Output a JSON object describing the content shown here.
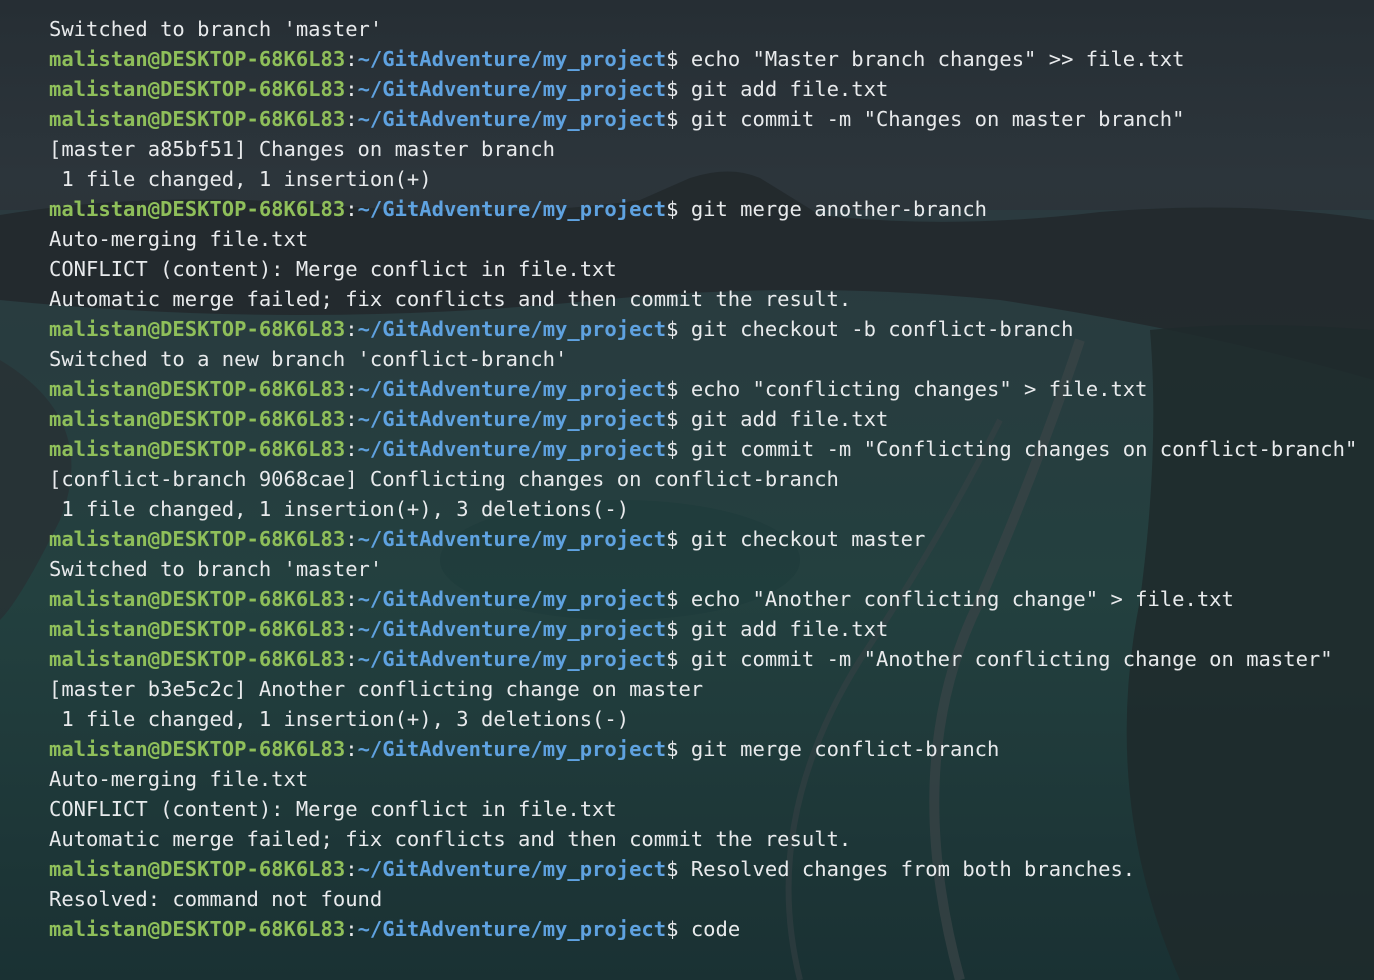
{
  "prompt": {
    "user_host": "malistan@DESKTOP-68K6L83",
    "separator": ":",
    "path": "~/GitAdventure/my_project",
    "symbol": "$ "
  },
  "lines": [
    {
      "type": "output",
      "text": "Switched to branch 'master'"
    },
    {
      "type": "prompt",
      "command": "echo \"Master branch changes\" >> file.txt"
    },
    {
      "type": "prompt",
      "command": "git add file.txt"
    },
    {
      "type": "prompt",
      "command": "git commit -m \"Changes on master branch\""
    },
    {
      "type": "output",
      "text": "[master a85bf51] Changes on master branch"
    },
    {
      "type": "output",
      "text": " 1 file changed, 1 insertion(+)"
    },
    {
      "type": "prompt",
      "command": "git merge another-branch"
    },
    {
      "type": "output",
      "text": "Auto-merging file.txt"
    },
    {
      "type": "output",
      "text": "CONFLICT (content): Merge conflict in file.txt"
    },
    {
      "type": "output",
      "text": "Automatic merge failed; fix conflicts and then commit the result."
    },
    {
      "type": "prompt",
      "command": "git checkout -b conflict-branch"
    },
    {
      "type": "output",
      "text": "Switched to a new branch 'conflict-branch'"
    },
    {
      "type": "prompt",
      "command": "echo \"conflicting changes\" > file.txt"
    },
    {
      "type": "prompt",
      "command": "git add file.txt"
    },
    {
      "type": "prompt",
      "command": "git commit -m \"Conflicting changes on conflict-branch\""
    },
    {
      "type": "output",
      "text": "[conflict-branch 9068cae] Conflicting changes on conflict-branch"
    },
    {
      "type": "output",
      "text": " 1 file changed, 1 insertion(+), 3 deletions(-)"
    },
    {
      "type": "prompt",
      "command": "git checkout master"
    },
    {
      "type": "output",
      "text": "Switched to branch 'master'"
    },
    {
      "type": "prompt",
      "command": "echo \"Another conflicting change\" > file.txt"
    },
    {
      "type": "prompt",
      "command": "git add file.txt"
    },
    {
      "type": "prompt",
      "command": "git commit -m \"Another conflicting change on master\""
    },
    {
      "type": "output",
      "text": "[master b3e5c2c] Another conflicting change on master"
    },
    {
      "type": "output",
      "text": " 1 file changed, 1 insertion(+), 3 deletions(-)"
    },
    {
      "type": "prompt",
      "command": "git merge conflict-branch"
    },
    {
      "type": "output",
      "text": "Auto-merging file.txt"
    },
    {
      "type": "output",
      "text": "CONFLICT (content): Merge conflict in file.txt"
    },
    {
      "type": "output",
      "text": "Automatic merge failed; fix conflicts and then commit the result."
    },
    {
      "type": "prompt",
      "command": "Resolved changes from both branches."
    },
    {
      "type": "output",
      "text": "Resolved: command not found"
    },
    {
      "type": "prompt",
      "command": "code"
    }
  ],
  "colors": {
    "user_host": "#8fbf5a",
    "path": "#5fa2e0",
    "text": "#e8eaec",
    "background": "#1c2328"
  }
}
